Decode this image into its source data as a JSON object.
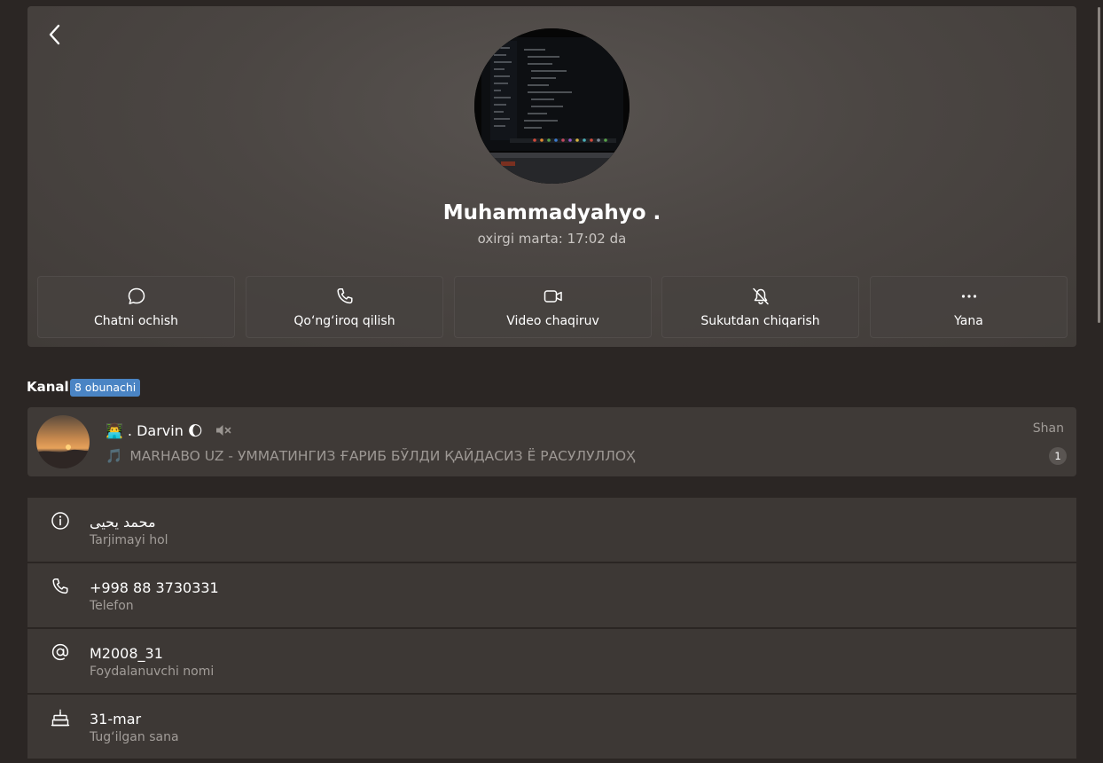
{
  "profile": {
    "name": "Muhammadyahyo .",
    "status": "oxirgi marta: 17:02 da"
  },
  "actions": [
    {
      "label": "Chatni ochish",
      "icon": "chat-bubble-icon"
    },
    {
      "label": "Qo‘ng‘iroq qilish",
      "icon": "phone-icon"
    },
    {
      "label": "Video chaqiruv",
      "icon": "video-camera-icon"
    },
    {
      "label": "Sukutdan chiqarish",
      "icon": "bell-off-icon"
    },
    {
      "label": "Yana",
      "icon": "more-dots-icon"
    }
  ],
  "channel_section": {
    "title": "Kanal",
    "badge": "8 obunachi"
  },
  "channel": {
    "name_prefix": "👨‍💻",
    "name": ". Darvin",
    "name_suffix": "🌔",
    "muted_icon": "speaker-muted-icon",
    "time": "Shan",
    "message_prefix": "🎵",
    "message": "MARHABO UZ - УММАТИНГИЗ ҒАРИБ БЎЛДИ ҚАЙДАСИЗ Ё РАСУЛУЛЛОҲ",
    "unread": "1"
  },
  "info": [
    {
      "icon": "info-icon",
      "value": "محمد يحيى",
      "label": "Tarjimayi hol"
    },
    {
      "icon": "phone-icon",
      "value": "+998 88 3730331",
      "label": "Telefon"
    },
    {
      "icon": "at-sign-icon",
      "value": "M2008_31",
      "label": "Foydalanuvchi nomi"
    },
    {
      "icon": "cake-icon",
      "value": "31-mar",
      "label": "Tug‘ilgan sana"
    }
  ],
  "colors": {
    "background": "#2b2624",
    "badge": "#4a84c4",
    "card": "#3d3835"
  }
}
